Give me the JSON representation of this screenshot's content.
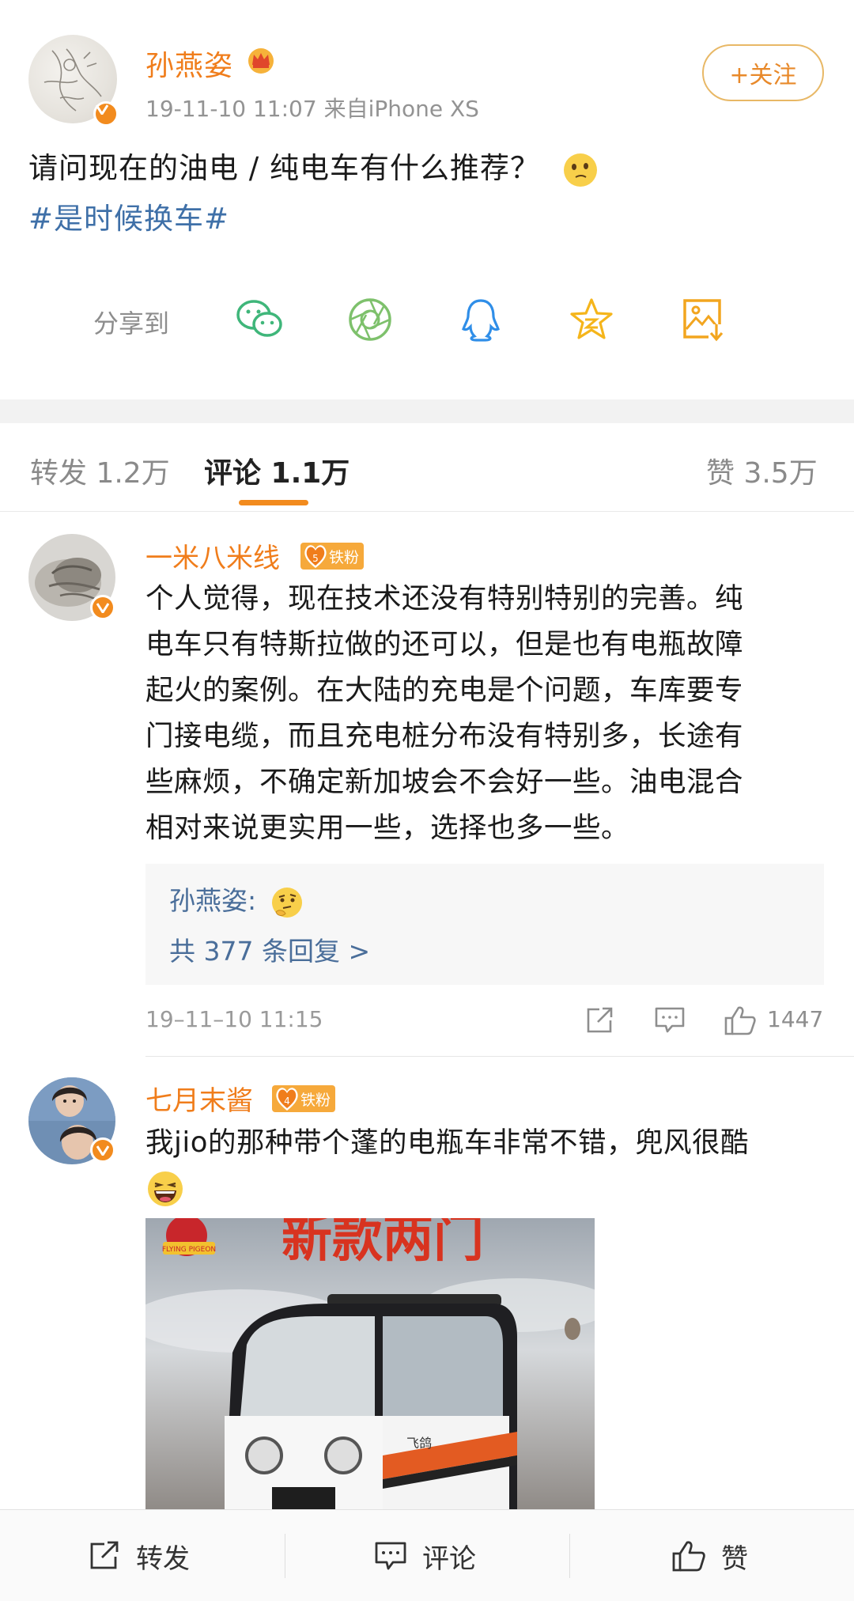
{
  "post": {
    "author": "孙燕姿",
    "meta": "19-11-10 11:07  来自iPhone XS",
    "follow_label": "+关注",
    "text": "请问现在的油电 / 纯电车有什么推荐？",
    "hashtag": "#是时候换车#",
    "share_label": "分享到",
    "share_targets": [
      "wechat-icon",
      "moments-icon",
      "qq-icon",
      "qzone-icon",
      "save-image-icon"
    ]
  },
  "tabs": {
    "repost": "转发 1.2万",
    "comments": "评论 1.1万",
    "likes": "赞 3.5万"
  },
  "comments": [
    {
      "name": "一米八米线",
      "badge_level": "5",
      "badge_label": "铁粉",
      "lines": [
        "个人觉得，现在技术还没有特别特别的完善。纯",
        "电车只有特斯拉做的还可以，但是也有电瓶故障",
        "起火的案例。在大陆的充电是个问题，车库要专",
        "门接电缆，而且充电桩分布没有特别多，长途有",
        "些麻烦，不确定新加坡会不会好一些。油电混合",
        "相对来说更实用一些，选择也多一些。"
      ],
      "reply_author": "孙燕姿:",
      "reply_more": "共 377 条回复 >",
      "time": "19–11–10 11:15",
      "likes": "1447"
    },
    {
      "name": "七月末酱",
      "badge_level": "4",
      "badge_label": "铁粉",
      "lines": [
        "我jio的那种带个蓬的电瓶车非常不错，兜风很酷"
      ]
    }
  ],
  "photo": {
    "headline": "新款两门",
    "logo_text": "FLYING PIGEON",
    "brand_text": "飞鸽"
  },
  "bottom_bar": {
    "repost": "转发",
    "comment": "评论",
    "like": "赞"
  },
  "colors": {
    "accent": "#f07d1b",
    "link": "#3f70a8",
    "badge": "#f6a93b"
  }
}
